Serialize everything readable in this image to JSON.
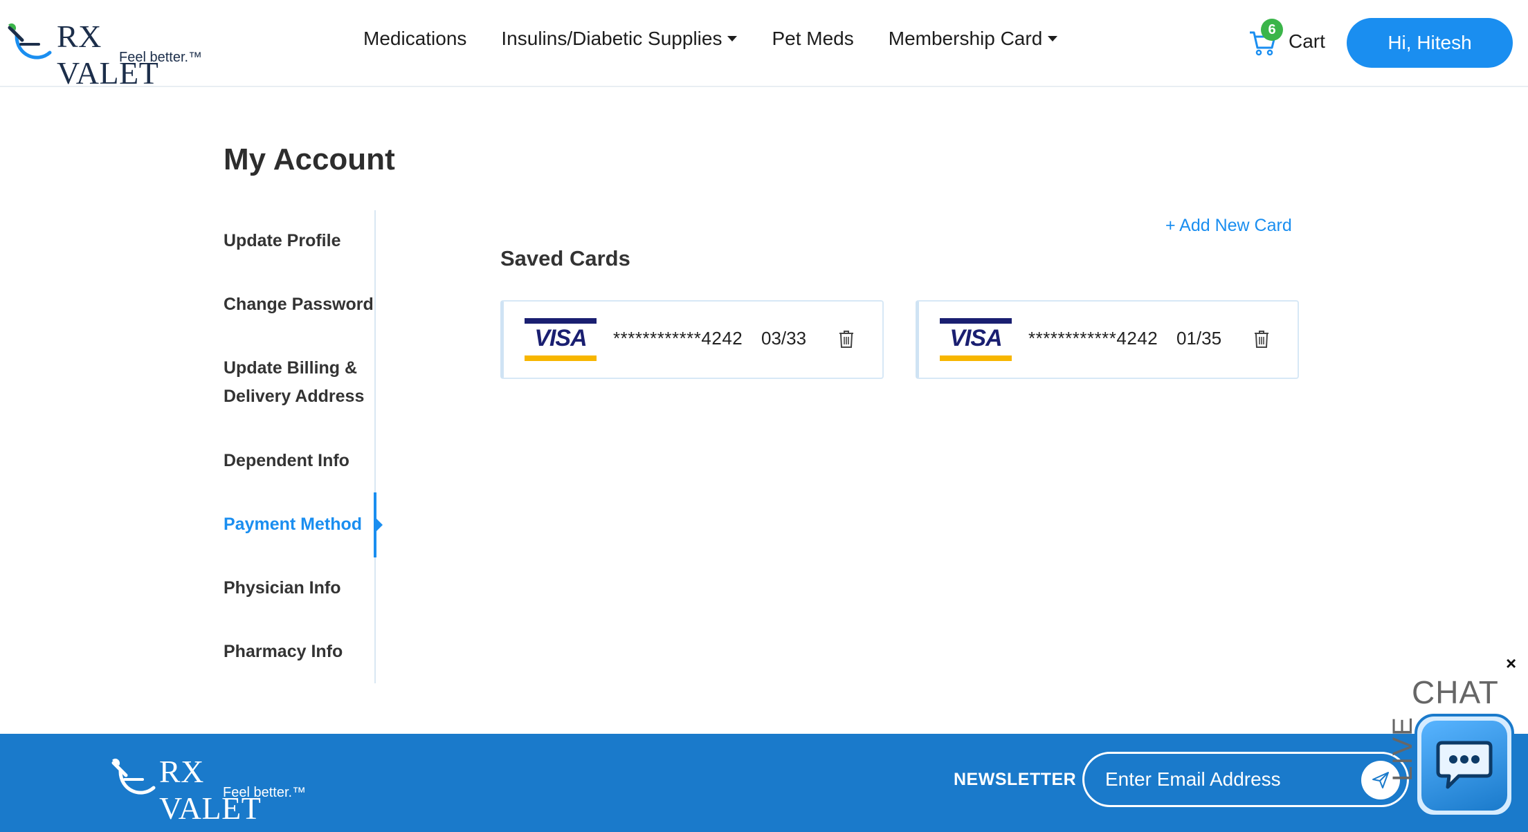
{
  "brand": {
    "name": "RX VALET",
    "tagline": "Feel better.™"
  },
  "nav": {
    "items": [
      {
        "label": "Medications",
        "dropdown": false
      },
      {
        "label": "Insulins/Diabetic Supplies",
        "dropdown": true
      },
      {
        "label": "Pet Meds",
        "dropdown": false
      },
      {
        "label": "Membership Card",
        "dropdown": true
      }
    ],
    "cart_label": "Cart",
    "cart_count": "6",
    "user_greeting": "Hi, Hitesh"
  },
  "page": {
    "title": "My Account"
  },
  "sidebar": {
    "items": [
      {
        "label": "Update Profile",
        "active": false
      },
      {
        "label": "Change Password",
        "active": false
      },
      {
        "label": "Update Billing &",
        "active": false
      },
      {
        "label": "Delivery Address",
        "active": false
      },
      {
        "label": "Dependent Info",
        "active": false
      },
      {
        "label": "Payment Method",
        "active": true
      },
      {
        "label": "Physician Info",
        "active": false
      },
      {
        "label": "Pharmacy Info",
        "active": false
      }
    ]
  },
  "main": {
    "add_card_label": "+ Add New Card",
    "section_title": "Saved Cards",
    "cards": [
      {
        "brand": "VISA",
        "number": "************4242",
        "expiry": "03/33"
      },
      {
        "brand": "VISA",
        "number": "************4242",
        "expiry": "01/35"
      }
    ]
  },
  "footer": {
    "newsletter_label": "NEWSLETTER",
    "email_placeholder": "Enter Email Address"
  },
  "chat": {
    "title": "CHAT",
    "live": "LIVE",
    "close": "×"
  },
  "colors": {
    "accent": "#1a8ef0",
    "footer": "#1a7acb",
    "badge": "#3bb54a",
    "visa_blue": "#1a1f71",
    "visa_gold": "#f7b600"
  }
}
